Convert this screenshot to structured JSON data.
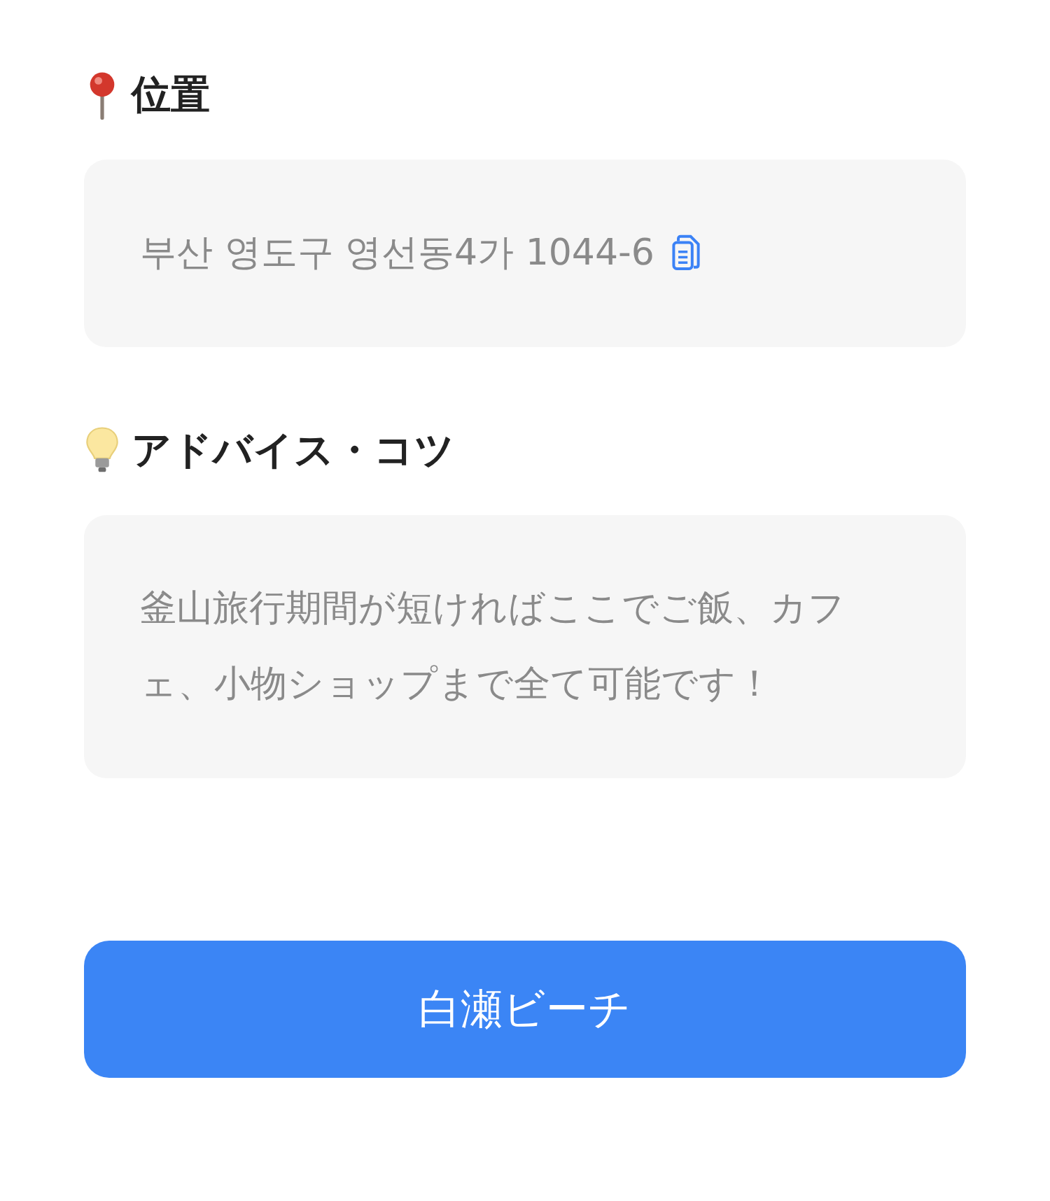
{
  "sections": [
    {
      "kind": "location",
      "title": "位置",
      "text": "부산 영도구 영선동4가 1044-6",
      "copyable": true
    },
    {
      "kind": "tip",
      "title": "アドバイス・コツ",
      "text": "釜山旅行期間が短ければここでご飯、カフェ、小物ショップまで全て可能です！",
      "copyable": false
    }
  ],
  "button": {
    "label": "白瀬ビーチ"
  }
}
